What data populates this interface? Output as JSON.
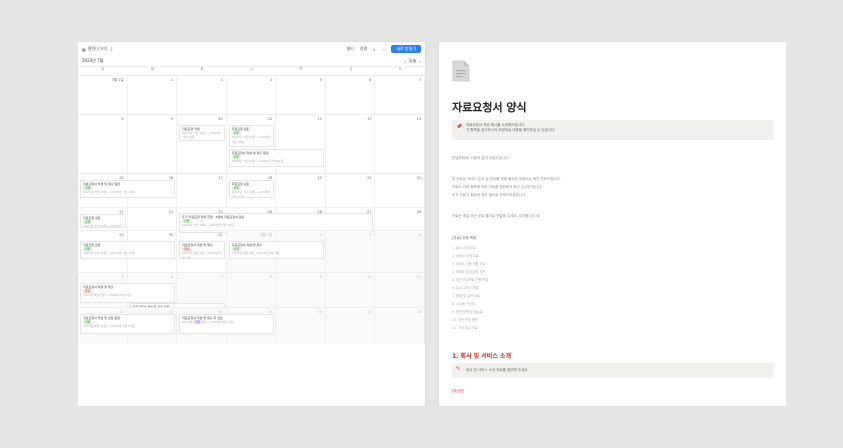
{
  "calendar": {
    "view_name": "캘린더 보기",
    "view_count": "1",
    "toolbar_filter": "필터",
    "toolbar_sort": "정렬",
    "toolbar_search_icon": "search-icon",
    "new_button": "새로 만들기",
    "month_label": "2023년 7월",
    "today_label": "오늘",
    "weekdays": [
      "일",
      "월",
      "화",
      "수",
      "목",
      "금",
      "토"
    ],
    "weeks": [
      {
        "days": [
          "7월 1일",
          "2",
          "3",
          "4",
          "5",
          "6",
          "7"
        ]
      },
      {
        "days": [
          "8",
          "9",
          "10",
          "11",
          "12",
          "13",
          "14"
        ]
      },
      {
        "days": [
          "15",
          "16",
          "17",
          "18",
          "19",
          "20",
          "21"
        ]
      },
      {
        "days": [
          "22",
          "23",
          "24",
          "25",
          "26",
          "27",
          "28"
        ]
      },
      {
        "days": [
          "29",
          "30",
          "31",
          "8월 1일",
          "2",
          "3",
          "4"
        ]
      },
      {
        "days": [
          "5",
          "6",
          "7",
          "8",
          "9",
          "10",
          "11"
        ]
      },
      {
        "days": [
          "12",
          "13",
          "14",
          "15",
          "16",
          "17",
          "18"
        ]
      }
    ],
    "events": [
      {
        "title": "자료요청 작업",
        "sub": "2023년 7월 10일 → 2023년 7월 12일"
      },
      {
        "title": "자료요청 검토",
        "tag": "진행",
        "sub": "2023년 7월 12일 → 2023년 7월 14일"
      },
      {
        "title": "자료요청서 작성 및 제출 일정",
        "tag": "진행",
        "sub": "2023년 7월 12일 → 2023년 7월 14일"
      },
      {
        "title": "자료요청서 작성 및 제출 일정",
        "tag": "진행",
        "sub": "2023년 7월 15일 → 2023년 7월 18일"
      },
      {
        "title": "자료요청 검토",
        "tag": "진행",
        "sub": "2023년 7월 19일 → 2023년 7월 20일"
      },
      {
        "title": "추가 자료요청 작업 진행 - 4월분 자료요청서 검토",
        "tag": "진행",
        "sub": "2023년 7월 18일 → 2023년 7월 21일"
      },
      {
        "title": "자료요청 검토",
        "tag": "진행",
        "sub": "2023년 7월 22일 → 2023년 7월 23일"
      },
      {
        "title": "자료요청 검토",
        "tag": "진행",
        "sub": "2023년 7월 29일 → 2023년 7월 31일"
      },
      {
        "title": "자료요청서 작성 및 제출",
        "tag": "완료",
        "sub": "2023년 8월 1일 → 2023년 8월 2일"
      },
      {
        "title": "자료요청서 작성 및 제출",
        "tag": "진행",
        "sub": "2023년 8월 2일 → 2023년 8월 4일"
      },
      {
        "title": "자료요청서 작성 및 제출",
        "tag": "완료",
        "sub": "2023년 8월 5일 → 2023년 8월 7일"
      },
      {
        "title": "자료요청서 작성 및 검토 일정",
        "sub": "2023년 8월 6일 → 2023년 8월 10일"
      },
      {
        "title": "자료요청서 작성 및 검토 일정",
        "tag": "진행",
        "sub": "2023년 8월 12일 → 2023년 8월 15일"
      },
      {
        "title": "자료요청서 작성 및 제출 후 검토",
        "tag": "확인",
        "sub": "2023년 8월 15일 → 2023년 8월 17일"
      }
    ]
  },
  "doc": {
    "title": "자료요청서 양식",
    "callout_icon": "pin-icon",
    "callout_lines": [
      "자료요청서 작성 예시를 소개해드립니다.",
      "각 항목을 참고하시어 요청하실 내용을 확인하실 수 있습니다."
    ],
    "intro": "안녕하세요! 다음과 같이 요청드립니다.",
    "para1": [
      "본 자료는 서비스 분석 및 검토를 위해 필요한 내용으로 확인 부탁드립니다.",
      "자료는 아래 항목에 따라 가능한 범위에서 회신 주시면 됩니다.",
      "추가 자료가 필요한 경우 별도로 연락드리겠습니다."
    ],
    "para2": "자료는 메일 또는 공유 폴더로 전달해 주세요. 감사합니다 😊",
    "list_heading": "[자료] 요청 목록",
    "list": [
      "1. 회사 소개 자료",
      "2. 서비스 소개 자료",
      "3. 서비스 이용 현황 자료",
      "4. 조직도 및 담당자 정보",
      "5. 최근 프로젝트 진행 현황",
      "6. 주요 고객사 목록",
      "7. 매출 및 실적 자료",
      "8. 시스템 구성도",
      "9. 운영 정책 및 매뉴얼",
      "10. 보안 관련 정책",
      "11. 기타 참고 자료"
    ],
    "section_heading": "1. 회사 및 서비스 소개",
    "callout2_icon": "pencil-icon",
    "callout2_text": "회사 및 서비스 소개 자료를 첨부해 주세요.",
    "red_note": "[작성란]"
  }
}
